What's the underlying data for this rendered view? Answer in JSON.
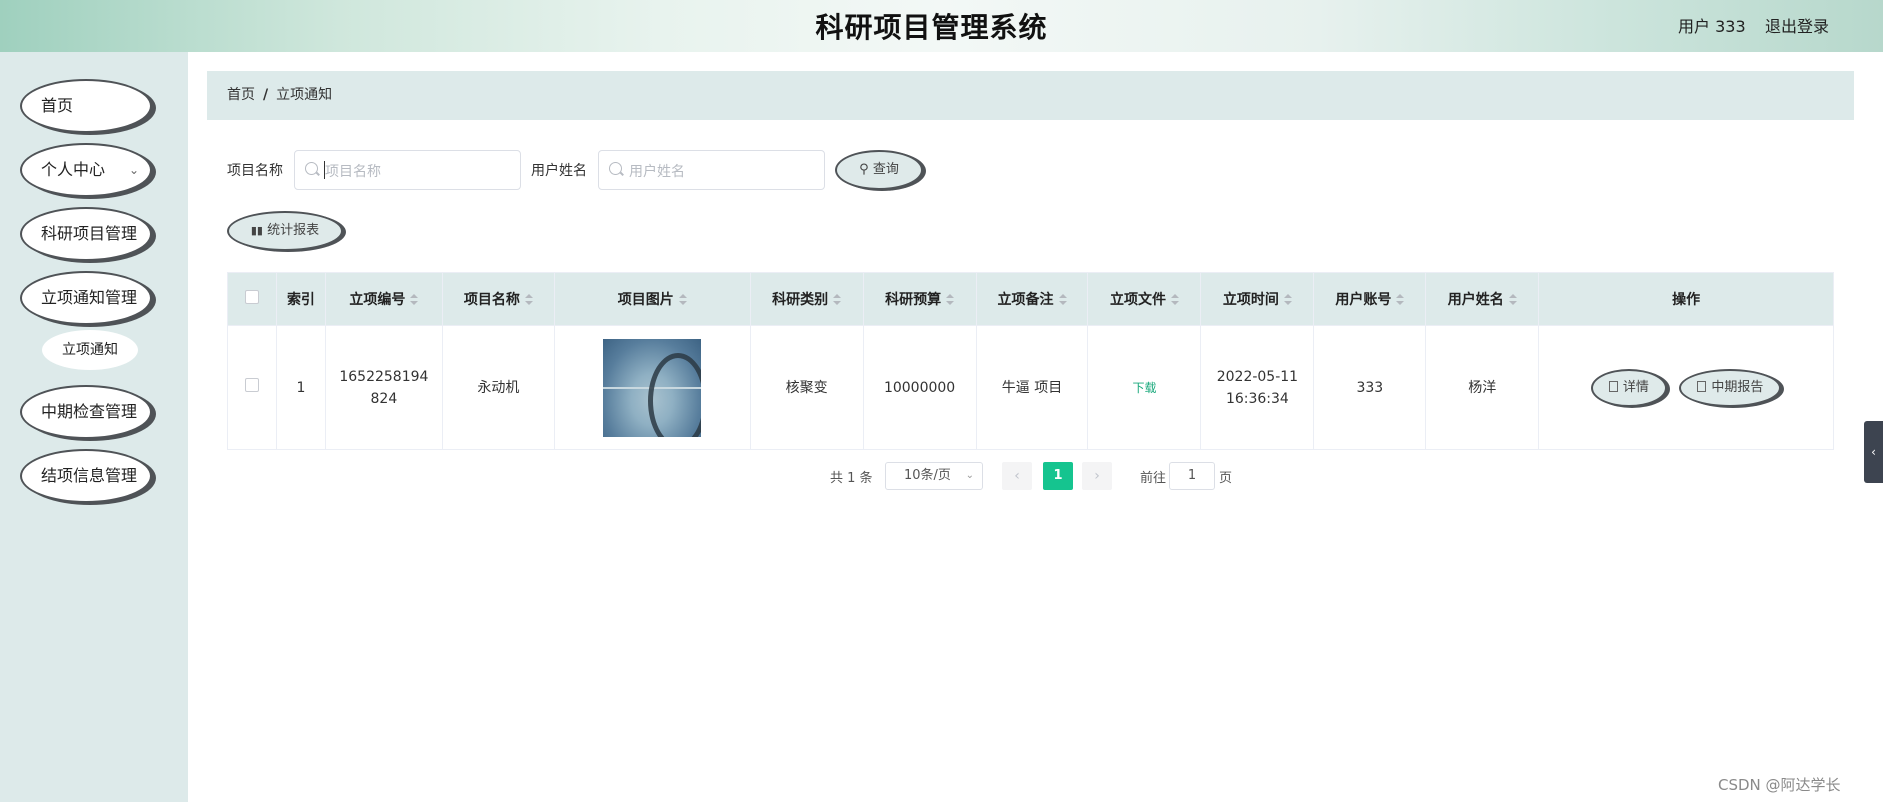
{
  "header": {
    "title": "科研项目管理系统",
    "user_label": "用户 333",
    "logout_label": "退出登录"
  },
  "sidebar": {
    "items": [
      {
        "label": "首页"
      },
      {
        "label": "个人中心"
      },
      {
        "label": "科研项目管理"
      },
      {
        "label": "立项通知管理"
      },
      {
        "label": "中期检查管理"
      },
      {
        "label": "结项信息管理"
      }
    ],
    "submenu": {
      "label": "立项通知"
    }
  },
  "breadcrumb": {
    "home": "首页",
    "separator": "/",
    "current": "立项通知"
  },
  "search": {
    "project_name_label": "项目名称",
    "project_name_placeholder": "项目名称",
    "user_name_label": "用户姓名",
    "user_name_placeholder": "用户姓名",
    "query_label": "查询",
    "report_label": "统计报表"
  },
  "table": {
    "columns": [
      "索引",
      "立项编号",
      "项目名称",
      "项目图片",
      "科研类别",
      "科研预算",
      "立项备注",
      "立项文件",
      "立项时间",
      "用户账号",
      "用户姓名",
      "操作"
    ],
    "rows": [
      {
        "index": "1",
        "code": "1652258194824",
        "name": "永动机",
        "category": "核聚变",
        "budget": "10000000",
        "remark": "牛逼 项目",
        "file": "下载",
        "time": "2022-05-11 16:36:34",
        "account": "333",
        "username": "杨洋",
        "actions": [
          "详情",
          "中期报告"
        ]
      }
    ]
  },
  "pagination": {
    "total": "共 1 条",
    "page_size": "10条/页",
    "current_page": "1",
    "goto_label": "前往",
    "goto_value": "1",
    "page_suffix": "页"
  },
  "watermark": "CSDN @阿达学长",
  "colors": {
    "accent_green": "#15c48f",
    "panel_bg": "#ddeaea",
    "outline": "#4f5357"
  }
}
